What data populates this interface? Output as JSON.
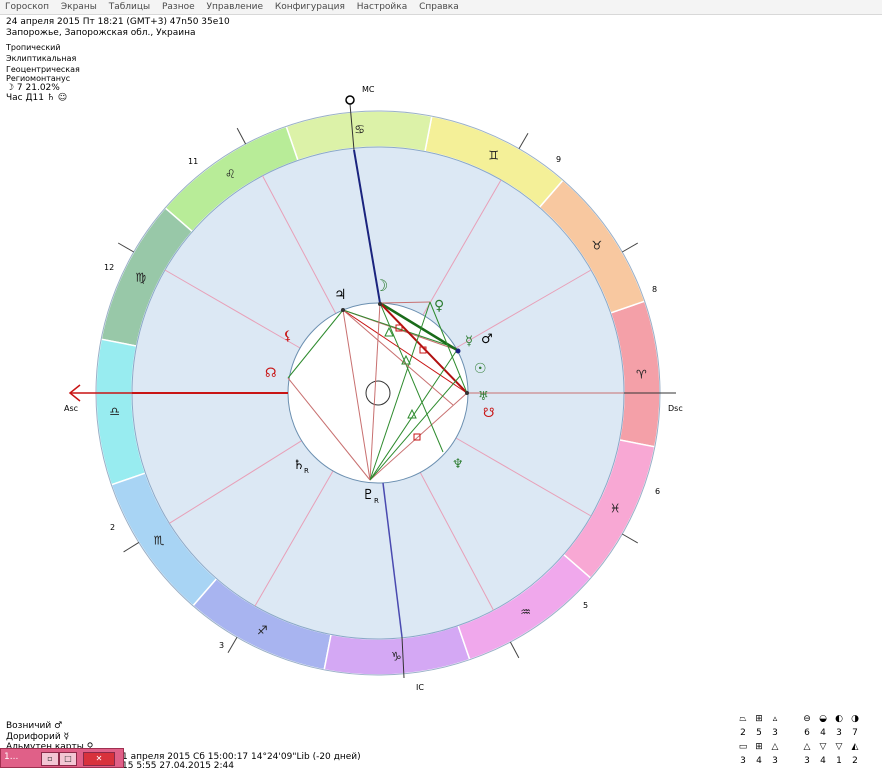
{
  "menu": [
    "Гороскоп",
    "Экраны",
    "Таблицы",
    "Разное",
    "Управление",
    "Конфигурация",
    "Настройка",
    "Справка"
  ],
  "header": {
    "line1": "24 апреля 2015  Пт  18:21 (GMT+3) 47n50  35e10",
    "line2": "Запорожье, Запорожская обл., Украина"
  },
  "settings": [
    "Тропический",
    "Эклиптикальная",
    "Геоцентрическая",
    "Региомонтанус"
  ],
  "moon_info": "☽  7 21.02%",
  "hour_info": "Час Д11  ♄  ☺",
  "chart_labels": {
    "mc": "MC",
    "ic": "IC",
    "asc": "Asc",
    "dsc": "Dsc"
  },
  "house_numbers": [
    "2",
    "3",
    "5",
    "6",
    "8",
    "9",
    "11",
    "12"
  ],
  "zodiac": [
    {
      "sign": "♈",
      "color": "#f4a0a8"
    },
    {
      "sign": "♉",
      "color": "#f8c8a0"
    },
    {
      "sign": "♊",
      "color": "#f4f098"
    },
    {
      "sign": "♋",
      "color": "#dcf2a8"
    },
    {
      "sign": "♌",
      "color": "#b8ec98"
    },
    {
      "sign": "♍",
      "color": "#98c8a8"
    },
    {
      "sign": "♎",
      "color": "#98ecf0"
    },
    {
      "sign": "♏",
      "color": "#a8d4f4"
    },
    {
      "sign": "♐",
      "color": "#a8b4f0"
    },
    {
      "sign": "♑",
      "color": "#d4a8f4"
    },
    {
      "sign": "♒",
      "color": "#f0a8ec"
    },
    {
      "sign": "♓",
      "color": "#f8a8d4"
    }
  ],
  "planets": {
    "jupiter": "♃",
    "moon": "☽",
    "venus": "♀",
    "mercury": "☿",
    "mars": "♂",
    "sun": "☉",
    "uranus": "♅",
    "neptune": "♆",
    "pluto": "♇",
    "saturn": "♄",
    "lilith": "⚸",
    "north_node": "☊",
    "south_node": "☋",
    "retro": "R"
  },
  "footer": {
    "voznich": "Возничий  ♂",
    "dorifor": "Дорифорий  ☿",
    "almuten": "Альмутен карты  ♀",
    "progress1": "1 апреля 2015 Сб 15:00:17 14°24'09\"Lib (-20 дней)",
    "progress2": "15  5:55   27.04.2015  2:44"
  },
  "aspect_table": {
    "row1_labels": [
      "2",
      "5",
      "3",
      "6",
      "4",
      "3",
      "7"
    ],
    "row2_labels": [
      "3",
      "4",
      "3",
      "3",
      "4",
      "1",
      "2"
    ]
  },
  "taskbar": {
    "title": "1..."
  }
}
